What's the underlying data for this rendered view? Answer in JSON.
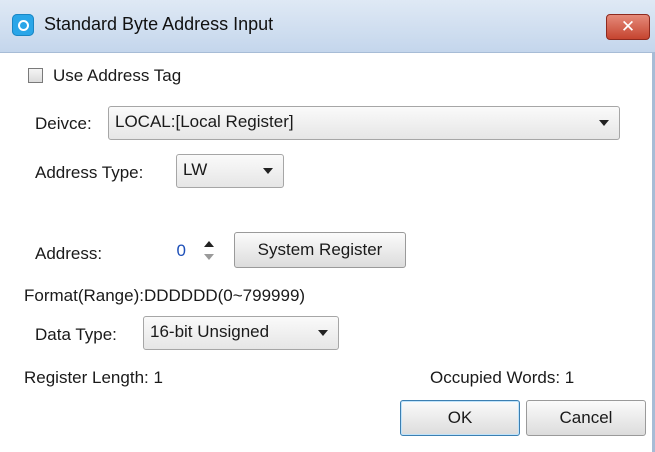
{
  "window": {
    "title": "Standard Byte Address Input",
    "close_glyph": "✕"
  },
  "use_address_tag": {
    "label": "Use Address Tag",
    "checked": false
  },
  "device": {
    "label": "Deivce:",
    "value": "LOCAL:[Local Register]"
  },
  "address_type": {
    "label": "Address Type:",
    "value": "LW"
  },
  "address": {
    "label": "Address:",
    "value": "0",
    "system_register_button": "System Register"
  },
  "format": {
    "text": "Format(Range):DDDDDD(0~799999)"
  },
  "data_type": {
    "label": "Data Type:",
    "value": "16-bit Unsigned"
  },
  "register_length": {
    "text": "Register Length: 1"
  },
  "occupied_words": {
    "text": "Occupied Words: 1"
  },
  "buttons": {
    "ok": "OK",
    "cancel": "Cancel"
  },
  "colors": {
    "titlebar": "#c4d6ec",
    "close_button": "#c5442f",
    "address_value": "#1d4fb8",
    "default_button_border": "#3c7fb1"
  },
  "icons": {
    "app": "app-logo-icon",
    "close": "close-icon",
    "dropdown": "chevron-down-icon",
    "spin_up": "spin-up-icon",
    "spin_down": "spin-down-icon",
    "checkbox": "checkbox-icon"
  }
}
